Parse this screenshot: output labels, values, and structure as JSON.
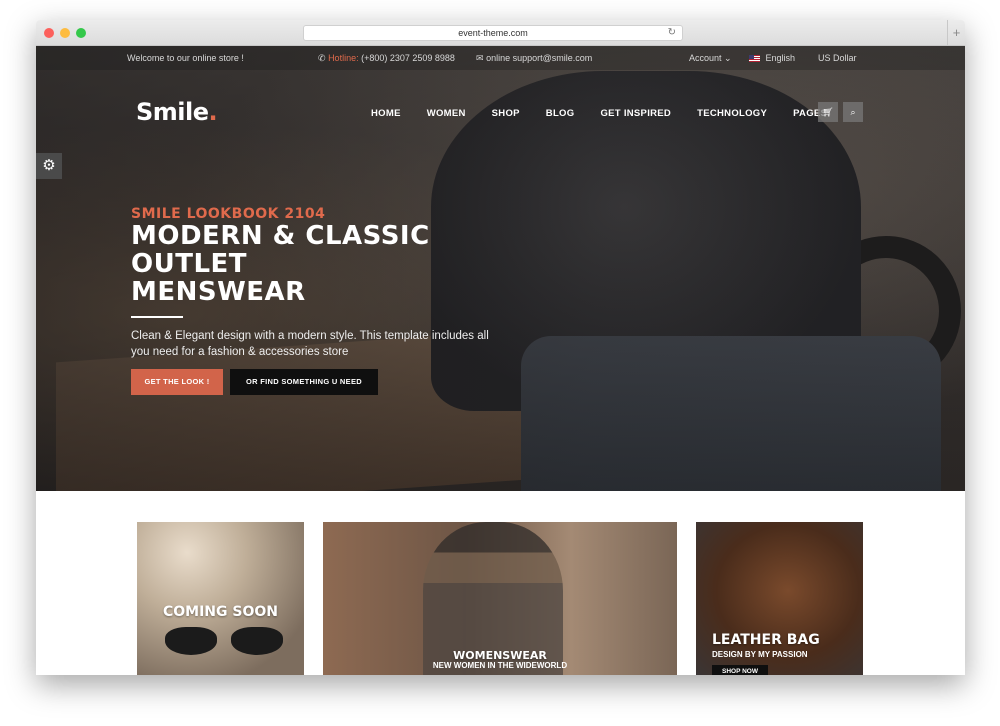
{
  "browser": {
    "url": "event-theme.com",
    "reload_icon": "reload-icon",
    "newtab_icon": "plus-icon"
  },
  "topbar": {
    "welcome": "Welcome to our online store !",
    "hotline_label": "Hotline:",
    "hotline_number": "(+800) 2307 2509 8988",
    "email": "online support@smile.com",
    "account": "Account",
    "language": "English",
    "currency": "US Dollar"
  },
  "brand": {
    "name": "Smile",
    "dot": ".",
    "accent": "#e06a4c"
  },
  "nav": {
    "items": [
      "HOME",
      "WOMEN",
      "SHOP",
      "BLOG",
      "GET INSPIRED",
      "TECHNOLOGY",
      "PAGES"
    ]
  },
  "hero": {
    "subtitle": "SMILE LOOKBOOK 2104",
    "headline_lines": [
      "MODERN & CLASSIC",
      "OUTLET",
      "MENSWEAR"
    ],
    "description": "Clean & Elegant design with a modern style. This template includes all you need for a fashion & accessories store",
    "cta_primary": "GET THE LOOK !",
    "cta_secondary": "OR FIND SOMETHING U NEED"
  },
  "cards": [
    {
      "title": "COMING SOON"
    },
    {
      "title": "WOMENSWEAR",
      "subtitle": "NEW WOMEN IN THE WIDEWORLD"
    },
    {
      "title": "LEATHER BAG",
      "subtitle": "DESIGN BY MY PASSION",
      "button": "SHOP NOW"
    }
  ]
}
